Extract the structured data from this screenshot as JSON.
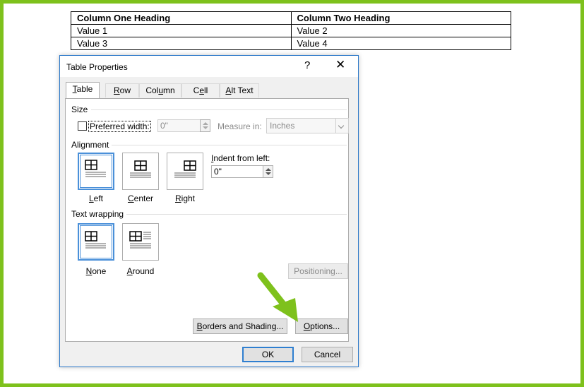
{
  "document_table": {
    "headers": [
      "Column One Heading",
      "Column Two Heading"
    ],
    "rows": [
      [
        "Value 1",
        "Value 2"
      ],
      [
        "Value 3",
        "Value 4"
      ]
    ]
  },
  "dialog": {
    "title": "Table Properties",
    "help": "?",
    "close": "✕",
    "tabs": [
      {
        "label": "Table",
        "mnemonic": "T",
        "rest": "able"
      },
      {
        "label": "Row",
        "mnemonic": "R",
        "rest": "ow"
      },
      {
        "label": "Column",
        "mnemonic": "U",
        "pre": "Col",
        "post": "mn"
      },
      {
        "label": "Cell",
        "mnemonic": "E",
        "pre": "C",
        "post": "ll"
      },
      {
        "label": "Alt Text",
        "mnemonic": "A",
        "rest": "lt Text"
      }
    ],
    "size": {
      "heading": "Size",
      "preferred_width_label": "Preferred width:",
      "preferred_width_value": "0\"",
      "measure_in_label": "Measure in:",
      "measure_in_value": "Inches"
    },
    "alignment": {
      "heading": "Alignment",
      "options": [
        "Left",
        "Center",
        "Right"
      ],
      "indent_label": "Indent from left:",
      "indent_value": "0\""
    },
    "text_wrapping": {
      "heading": "Text wrapping",
      "options": [
        "None",
        "Around"
      ]
    },
    "positioning_button": "Positioning...",
    "borders_button": "Borders and Shading...",
    "options_button": "Options...",
    "ok_button": "OK",
    "cancel_button": "Cancel"
  },
  "colors": {
    "frame": "#7ec11c",
    "accent": "#2b78c9",
    "arrow": "#7ec11c"
  },
  "icons": [
    "table-align-left-icon",
    "table-align-center-icon",
    "table-align-right-icon",
    "wrap-none-icon",
    "wrap-around-icon",
    "arrow-pointer-icon"
  ]
}
